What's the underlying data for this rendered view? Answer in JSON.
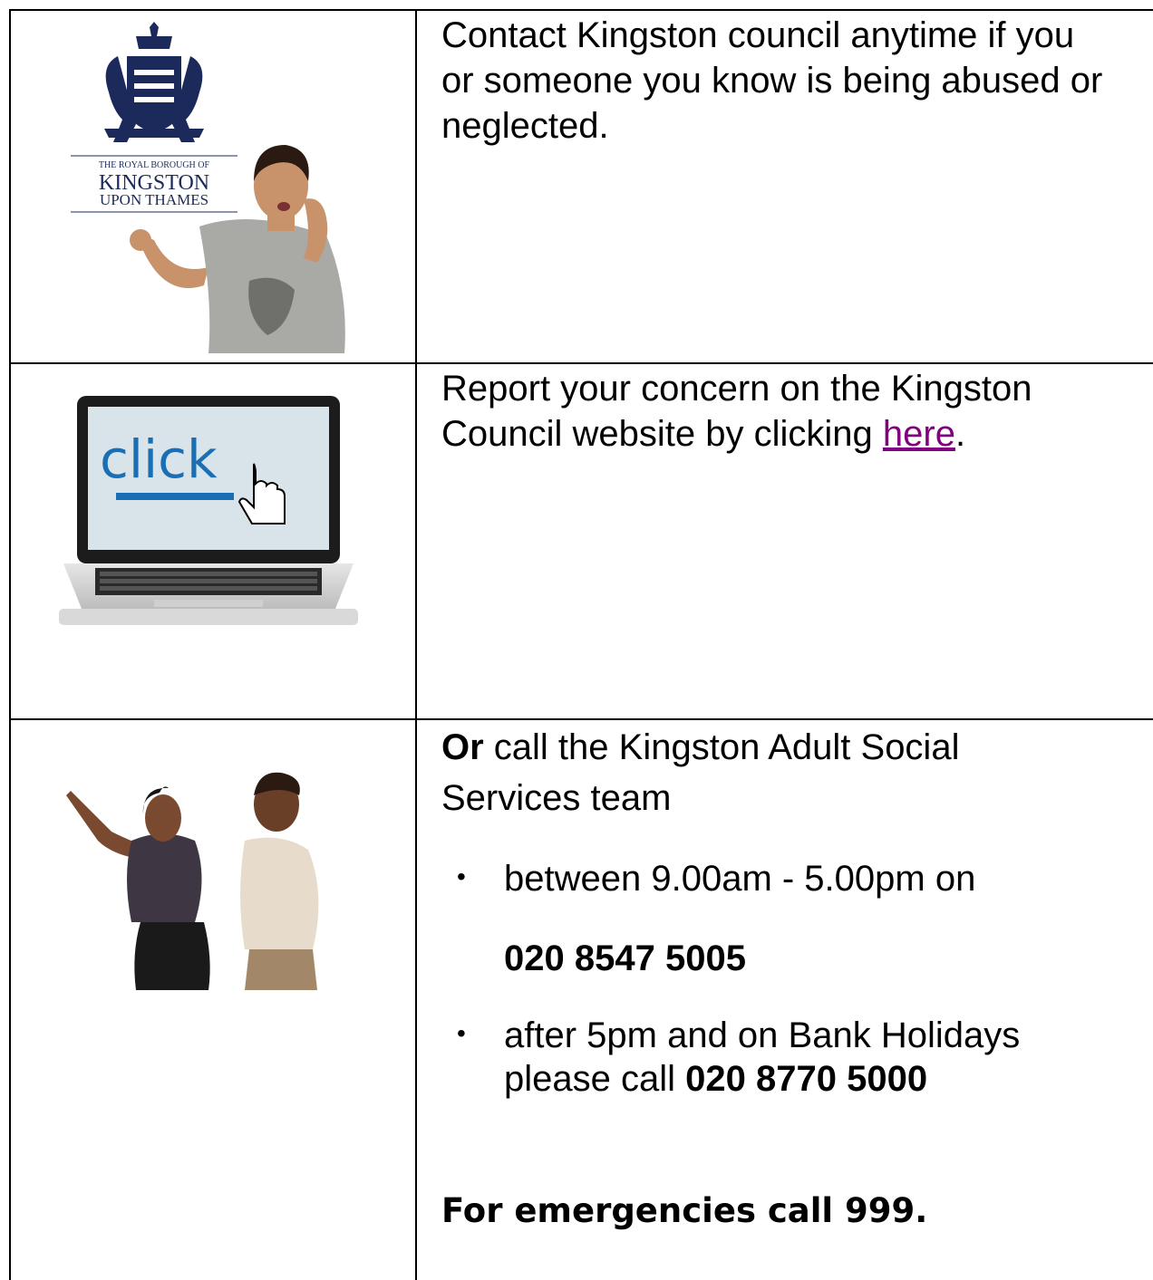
{
  "row1": {
    "logo_line1": "THE ROYAL BOROUGH OF",
    "logo_line2": "KINGSTON",
    "logo_line3": "UPON THAMES",
    "text": [
      "Contact Kingston council anytime if you",
      "or someone you know is being abused or",
      "neglected."
    ]
  },
  "row2": {
    "screen_word": "click",
    "text_line1": "Report your concern on the Kingston",
    "text_line2_before": "Council website by clicking ",
    "link_text": "here",
    "text_line2_after": "."
  },
  "row3": {
    "intro_bold": "Or",
    "intro_line1_rest": " call the Kingston Adult Social",
    "intro_line2": "Services team",
    "bullet1": "between 9.00am - 5.00pm on",
    "phone1": "020 8547 5005",
    "bullet2_line1": "after 5pm and on Bank Holidays",
    "bullet2_line2_before": "please call ",
    "phone2": "020 8770 5000",
    "emergency": "For emergencies call 999."
  },
  "colors": {
    "link": "#800080",
    "logo": "#1b2a5b",
    "click_blue": "#1a6fb4"
  }
}
